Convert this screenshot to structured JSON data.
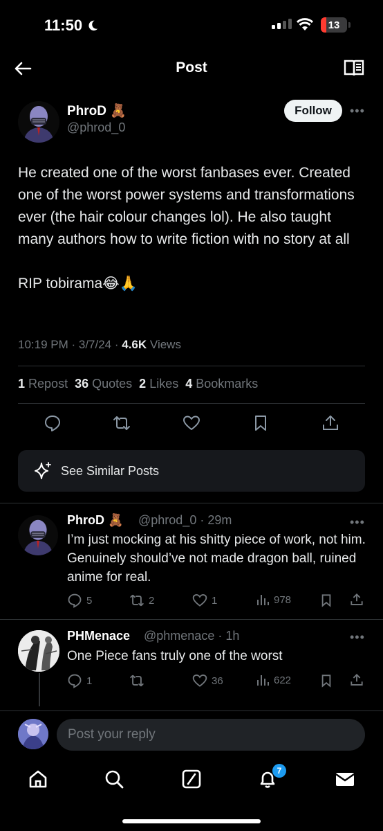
{
  "status": {
    "time": "11:50",
    "battery": "13"
  },
  "header": {
    "title": "Post"
  },
  "post": {
    "author_name": "PhroD",
    "author_emoji": "🧸",
    "handle": "@phrod_0",
    "follow_label": "Follow",
    "text": "He created one of the worst fanbases ever. Created one of the worst power systems and transformations ever (the hair colour changes lol). He also taught many authors how to write fiction with no story at all\n\nRIP tobirama😂🙏",
    "time": "10:19 PM",
    "date": "3/7/24",
    "views_count": "4.6K",
    "views_label": "Views",
    "reposts_count": "1",
    "reposts_label": "Repost",
    "quotes_count": "36",
    "quotes_label": "Quotes",
    "likes_count": "2",
    "likes_label": "Likes",
    "bookmarks_count": "4",
    "bookmarks_label": "Bookmarks"
  },
  "similar": {
    "label": "See Similar Posts"
  },
  "replies": [
    {
      "name": "PhroD",
      "emoji": "🧸",
      "handle": "@phrod_0",
      "age": "29m",
      "text": "I’m just mocking at his shitty piece of work, not him. Genuinely should’ve not made dragon ball, ruined anime for real.",
      "replies": "5",
      "reposts": "2",
      "likes": "1",
      "views": "978"
    },
    {
      "name": "PHMenace",
      "handle": "@phmenace",
      "age": "1h",
      "text": "One Piece fans truly one of the worst",
      "replies": "1",
      "reposts": "",
      "likes": "36",
      "views": "622"
    }
  ],
  "composer": {
    "placeholder": "Post your reply"
  },
  "nav": {
    "notifications_badge": "7"
  },
  "colors": {
    "accent": "#1d9bf0",
    "background": "#000000",
    "muted": "#71767b"
  }
}
